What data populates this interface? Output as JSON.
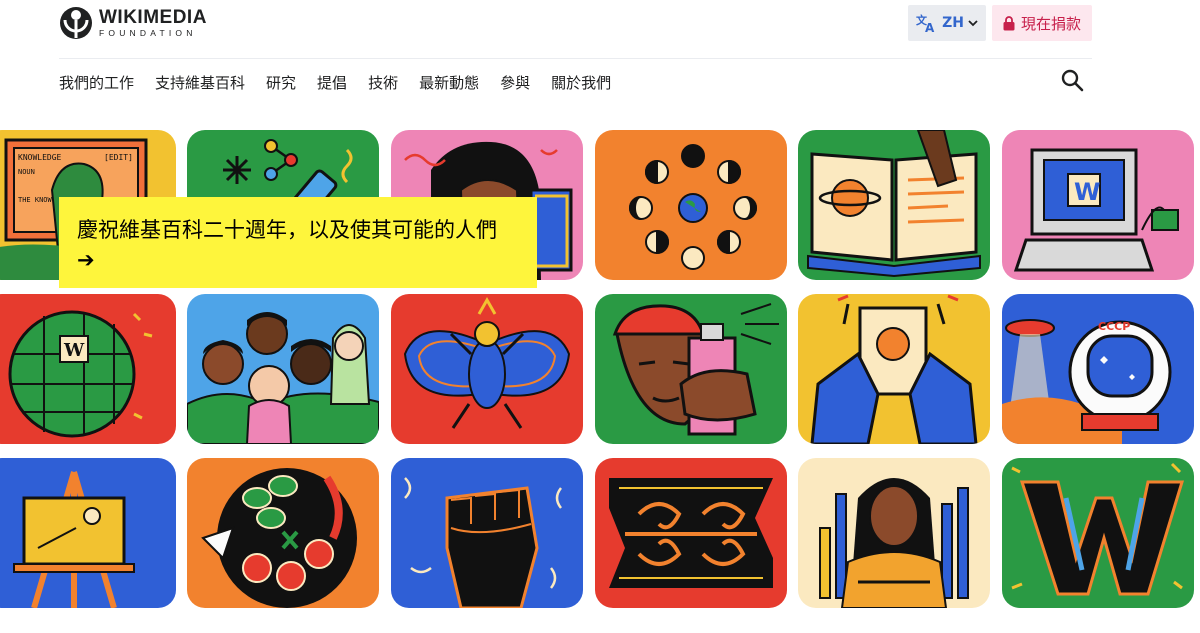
{
  "header": {
    "logo_word": "WIKIMEDIA",
    "logo_sub": "FOUNDATION",
    "lang_code": "ZH",
    "donate_label": "現在捐款"
  },
  "nav": {
    "items": [
      "我們的工作",
      "支持維基百科",
      "研究",
      "提倡",
      "技術",
      "最新動態",
      "參與",
      "關於我們"
    ]
  },
  "banner": {
    "text": "慶祝維基百科二十週年，以及使其可能的人們 ➔"
  },
  "tiles": {
    "knowledge_label": "KNOWLEDGE",
    "edit_label": "[EDIT]",
    "noun_label": "NOUN",
    "the_know_label": "THE KNOW",
    "cccp_label": "CCCP",
    "w_letter": "W"
  },
  "colors": {
    "accent_blue": "#3366cc",
    "donate_red": "#c7204b",
    "banner_yellow": "#fef53c"
  }
}
